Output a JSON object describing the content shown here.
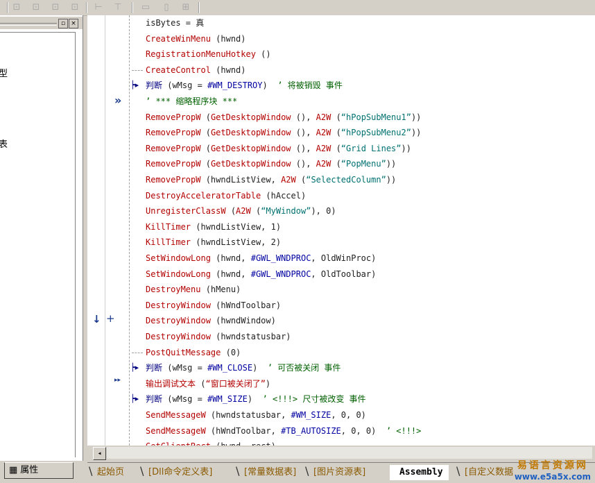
{
  "toolbar": {
    "icons": [
      "align-left-icon",
      "align-top-icon",
      "align-center-icon",
      "align-right-icon",
      "same-width-icon",
      "same-height-icon",
      "h-spacing-icon",
      "v-spacing-icon",
      "center-both-icon"
    ]
  },
  "left_panel": {
    "pin_glyph": "▫",
    "close_glyph": "×",
    "fragments": [
      "型",
      "表"
    ],
    "properties_tab": "属性"
  },
  "code_lines": [
    {
      "parts": [
        [
          "id",
          "isBytes = 真"
        ]
      ]
    },
    {
      "parts": [
        [
          "kw",
          "CreateWinMenu"
        ],
        [
          "id",
          " (hwnd)"
        ]
      ]
    },
    {
      "parts": [
        [
          "kw",
          "RegistrationMenuHotkey"
        ],
        [
          "id",
          " ()"
        ]
      ]
    },
    {
      "parts": [
        [
          "kw",
          "CreateControl"
        ],
        [
          "id",
          " (hwnd)"
        ]
      ]
    },
    {
      "parts": [
        [
          "cn-b",
          "判断 "
        ],
        [
          "id",
          "(wMsg = "
        ],
        [
          "cn",
          "#WM_DESTROY"
        ],
        [
          "id",
          ")  "
        ],
        [
          "cm",
          "’ 将被销毁 事件"
        ]
      ]
    },
    {
      "parts": [
        [
          "cm",
          "’ *** 缩略程序块 ***"
        ]
      ]
    },
    {
      "parts": [
        [
          "kw",
          "RemovePropW"
        ],
        [
          "id",
          " ("
        ],
        [
          "kw",
          "GetDesktopWindow"
        ],
        [
          "id",
          " (), "
        ],
        [
          "kw",
          "A2W"
        ],
        [
          "id",
          " ("
        ],
        [
          "st",
          "“hPopSubMenu1”"
        ],
        [
          "id",
          "))"
        ]
      ]
    },
    {
      "parts": [
        [
          "kw",
          "RemovePropW"
        ],
        [
          "id",
          " ("
        ],
        [
          "kw",
          "GetDesktopWindow"
        ],
        [
          "id",
          " (), "
        ],
        [
          "kw",
          "A2W"
        ],
        [
          "id",
          " ("
        ],
        [
          "st",
          "“hPopSubMenu2”"
        ],
        [
          "id",
          "))"
        ]
      ]
    },
    {
      "parts": [
        [
          "kw",
          "RemovePropW"
        ],
        [
          "id",
          " ("
        ],
        [
          "kw",
          "GetDesktopWindow"
        ],
        [
          "id",
          " (), "
        ],
        [
          "kw",
          "A2W"
        ],
        [
          "id",
          " ("
        ],
        [
          "st",
          "“Grid Lines”"
        ],
        [
          "id",
          "))"
        ]
      ]
    },
    {
      "parts": [
        [
          "kw",
          "RemovePropW"
        ],
        [
          "id",
          " ("
        ],
        [
          "kw",
          "GetDesktopWindow"
        ],
        [
          "id",
          " (), "
        ],
        [
          "kw",
          "A2W"
        ],
        [
          "id",
          " ("
        ],
        [
          "st",
          "“PopMenu”"
        ],
        [
          "id",
          "))"
        ]
      ]
    },
    {
      "parts": [
        [
          "kw",
          "RemovePropW"
        ],
        [
          "id",
          " (hwndListView, "
        ],
        [
          "kw",
          "A2W"
        ],
        [
          "id",
          " ("
        ],
        [
          "st",
          "“SelectedColumn”"
        ],
        [
          "id",
          "))"
        ]
      ]
    },
    {
      "parts": [
        [
          "kw",
          "DestroyAcceleratorTable"
        ],
        [
          "id",
          " (hAccel)"
        ]
      ]
    },
    {
      "parts": [
        [
          "kw",
          "UnregisterClassW"
        ],
        [
          "id",
          " ("
        ],
        [
          "kw",
          "A2W"
        ],
        [
          "id",
          " ("
        ],
        [
          "st",
          "“MyWindow”"
        ],
        [
          "id",
          "), 0)"
        ]
      ]
    },
    {
      "parts": [
        [
          "kw",
          "KillTimer"
        ],
        [
          "id",
          " (hwndListView, 1)"
        ]
      ]
    },
    {
      "parts": [
        [
          "kw",
          "KillTimer"
        ],
        [
          "id",
          " (hwndListView, 2)"
        ]
      ]
    },
    {
      "parts": [
        [
          "kw",
          "SetWindowLong"
        ],
        [
          "id",
          " (hwnd, "
        ],
        [
          "cn",
          "#GWL_WNDPROC"
        ],
        [
          "id",
          ", OldWinProc)"
        ]
      ]
    },
    {
      "parts": [
        [
          "kw",
          "SetWindowLong"
        ],
        [
          "id",
          " (hwnd, "
        ],
        [
          "cn",
          "#GWL_WNDPROC"
        ],
        [
          "id",
          ", OldToolbar)"
        ]
      ]
    },
    {
      "parts": [
        [
          "kw",
          "DestroyMenu"
        ],
        [
          "id",
          " (hMenu)"
        ]
      ]
    },
    {
      "parts": [
        [
          "kw",
          "DestroyWindow"
        ],
        [
          "id",
          " (hWndToolbar)"
        ]
      ]
    },
    {
      "parts": [
        [
          "kw",
          "DestroyWindow"
        ],
        [
          "id",
          " (hwndWindow)"
        ]
      ]
    },
    {
      "parts": [
        [
          "kw",
          "DestroyWindow"
        ],
        [
          "id",
          " (hwndstatusbar)"
        ]
      ]
    },
    {
      "parts": [
        [
          "kw",
          "PostQuitMessage"
        ],
        [
          "id",
          " (0)"
        ]
      ]
    },
    {
      "parts": [
        [
          "cn-b",
          "判断 "
        ],
        [
          "id",
          "(wMsg = "
        ],
        [
          "cn",
          "#WM_CLOSE"
        ],
        [
          "id",
          ")  "
        ],
        [
          "cm",
          "’ 可否被关闭 事件"
        ]
      ]
    },
    {
      "parts": [
        [
          "kw",
          "输出调试文本"
        ],
        [
          "id",
          " ("
        ],
        [
          "kw",
          "“窗口被关闭了”"
        ],
        [
          "id",
          ")"
        ]
      ]
    },
    {
      "parts": [
        [
          "cn-b",
          "判断 "
        ],
        [
          "id",
          "(wMsg = "
        ],
        [
          "cn",
          "#WM_SIZE"
        ],
        [
          "id",
          ")  "
        ],
        [
          "cm",
          "’ <!!!> 尺寸被改变 事件"
        ]
      ]
    },
    {
      "parts": [
        [
          "kw",
          "SendMessageW"
        ],
        [
          "id",
          " (hwndstatusbar, "
        ],
        [
          "cn",
          "#WM_SIZE"
        ],
        [
          "id",
          ", 0, 0)"
        ]
      ]
    },
    {
      "parts": [
        [
          "kw",
          "SendMessageW"
        ],
        [
          "id",
          " (hWndToolbar, "
        ],
        [
          "cn",
          "#TB_AUTOSIZE"
        ],
        [
          "id",
          ", 0, 0)  "
        ],
        [
          "cm",
          "’ <!!!>"
        ]
      ]
    },
    {
      "parts": [
        [
          "kw",
          "GetClientRect"
        ],
        [
          "id",
          " (hwnd, rect)"
        ]
      ]
    }
  ],
  "gutter": {
    "collapsed_marker": "»",
    "breakpoint_arrow": "↓",
    "add_marker": "+",
    "run_marker": "▸▸"
  },
  "scroll": {
    "left_arrow": "◂"
  },
  "tabs": [
    {
      "label": "起始页",
      "active": false
    },
    {
      "label": "[Dll命令定义表]",
      "active": false
    },
    {
      "label": "[常量数据表]",
      "active": false
    },
    {
      "label": "[图片资源表]",
      "active": false
    },
    {
      "label": "Assembly",
      "active": true
    },
    {
      "label": "[自定义数据",
      "active": false
    }
  ],
  "watermark": {
    "cn": "易语言资源网",
    "en": "www.e5a5x.com"
  }
}
